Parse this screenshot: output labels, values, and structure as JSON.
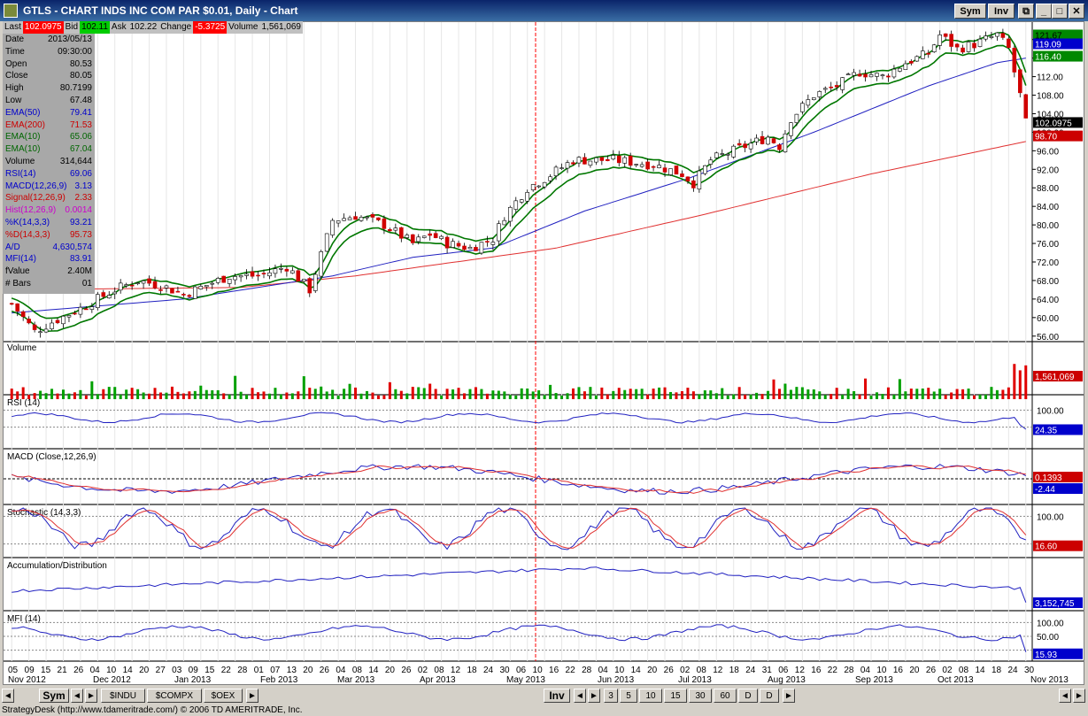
{
  "window": {
    "title": "GTLS - CHART INDS INC COM PAR $0.01, Daily - Chart",
    "sym_button": "Sym",
    "inv_button": "Inv"
  },
  "quote": {
    "last_label": "Last",
    "last_value": "102.0975",
    "bid_label": "Bid",
    "bid_value": "102.11",
    "ask_label": "Ask",
    "ask_value": "102.22",
    "change_label": "Change",
    "change_value": "-5.3725",
    "volume_label": "Volume",
    "volume_value": "1,561,069"
  },
  "data_panel": [
    {
      "k": "Date",
      "v": "2013/05/13",
      "color": "#000000"
    },
    {
      "k": "Time",
      "v": "09:30:00",
      "color": "#000000"
    },
    {
      "k": "Open",
      "v": "80.53",
      "color": "#000000"
    },
    {
      "k": "Close",
      "v": "80.05",
      "color": "#000000"
    },
    {
      "k": "High",
      "v": "80.7199",
      "color": "#000000"
    },
    {
      "k": "Low",
      "v": "67.48",
      "color": "#000000"
    },
    {
      "k": "EMA(50)",
      "v": "79.41",
      "color": "#0000cc"
    },
    {
      "k": "EMA(200)",
      "v": "71.53",
      "color": "#cc0000"
    },
    {
      "k": "EMA(10)",
      "v": "65.06",
      "color": "#006600"
    },
    {
      "k": "EMA(10)",
      "v": "67.04",
      "color": "#006600"
    },
    {
      "k": "Volume",
      "v": "314,644",
      "color": "#000000"
    },
    {
      "k": "RSI(14)",
      "v": "69.06",
      "color": "#0000cc"
    },
    {
      "k": "MACD(12,26,9)",
      "v": "3.13",
      "color": "#0000cc"
    },
    {
      "k": "Signal(12,26,9)",
      "v": "2.33",
      "color": "#cc0000"
    },
    {
      "k": "Hist(12,26,9)",
      "v": "0.0014",
      "color": "#cc00cc"
    },
    {
      "k": "%K(14,3,3)",
      "v": "93.21",
      "color": "#0000cc"
    },
    {
      "k": "%D(14,3,3)",
      "v": "95.73",
      "color": "#cc0000"
    },
    {
      "k": "A/D",
      "v": "4,630,574",
      "color": "#0000cc"
    },
    {
      "k": "MFI(14)",
      "v": "83.91",
      "color": "#0000cc"
    },
    {
      "k": "fValue",
      "v": "2.40M",
      "color": "#000000"
    },
    {
      "k": "# Bars",
      "v": "01",
      "color": "#000000"
    }
  ],
  "chart_data": {
    "type": "line",
    "price_axis": {
      "ylim": [
        55,
        123
      ],
      "ticks": [
        "120.00",
        "116.00",
        "112.00",
        "108.00",
        "104.00",
        "100.00",
        "96.00",
        "92.00",
        "88.00",
        "84.00",
        "80.00",
        "76.00",
        "72.00",
        "68.00",
        "64.00",
        "60.00",
        "56.00"
      ]
    },
    "price_keypoints": [
      [
        0,
        63
      ],
      [
        4,
        57
      ],
      [
        7,
        59
      ],
      [
        12,
        62
      ],
      [
        18,
        66
      ],
      [
        22,
        68
      ],
      [
        26,
        67
      ],
      [
        30,
        65
      ],
      [
        34,
        67
      ],
      [
        38,
        69
      ],
      [
        43,
        69
      ],
      [
        48,
        71
      ],
      [
        52,
        66
      ],
      [
        56,
        81
      ],
      [
        60,
        82
      ],
      [
        65,
        80
      ],
      [
        70,
        76
      ],
      [
        73,
        78
      ],
      [
        76,
        76
      ],
      [
        80,
        75
      ],
      [
        84,
        77
      ],
      [
        86,
        82
      ],
      [
        90,
        88
      ],
      [
        93,
        90
      ],
      [
        98,
        94
      ],
      [
        105,
        94
      ],
      [
        112,
        93
      ],
      [
        117,
        91
      ],
      [
        119,
        89
      ],
      [
        122,
        94
      ],
      [
        126,
        96
      ],
      [
        132,
        99
      ],
      [
        134,
        97
      ],
      [
        136,
        103
      ],
      [
        140,
        108
      ],
      [
        144,
        110
      ],
      [
        148,
        113
      ],
      [
        152,
        112
      ],
      [
        156,
        115
      ],
      [
        160,
        117
      ],
      [
        162,
        121
      ],
      [
        165,
        118
      ],
      [
        168,
        119
      ],
      [
        172,
        121
      ],
      [
        174,
        118
      ],
      [
        176,
        108
      ],
      [
        177,
        102
      ]
    ],
    "ema200_keypoints": [
      [
        0,
        66
      ],
      [
        40,
        66.5
      ],
      [
        60,
        69
      ],
      [
        95,
        75
      ],
      [
        120,
        82
      ],
      [
        150,
        91
      ],
      [
        177,
        98
      ]
    ],
    "ema50_keypoints": [
      [
        0,
        61
      ],
      [
        30,
        64
      ],
      [
        56,
        69
      ],
      [
        70,
        73
      ],
      [
        84,
        75
      ],
      [
        100,
        83
      ],
      [
        118,
        90
      ],
      [
        140,
        100
      ],
      [
        160,
        110
      ],
      [
        172,
        115
      ],
      [
        177,
        116
      ]
    ],
    "price_labels": [
      {
        "text": "121.67",
        "y": 121.0,
        "bg": "#008800",
        "fg": "#000000"
      },
      {
        "text": "119.09",
        "y": 119.09,
        "bg": "#0000cc",
        "fg": "#ffffff"
      },
      {
        "text": "116.40",
        "y": 116.4,
        "bg": "#008800",
        "fg": "#ffffff"
      },
      {
        "text": "102.0975",
        "y": 102.1,
        "bg": "#000000",
        "fg": "#ffffff"
      },
      {
        "text": "98.70",
        "y": 99.2,
        "bg": "#cc0000",
        "fg": "#ffffff"
      }
    ],
    "x_day_labels": [
      "05",
      "09",
      "15",
      "21",
      "26",
      "04",
      "10",
      "14",
      "20",
      "27",
      "03",
      "09",
      "15",
      "22",
      "28",
      "01",
      "07",
      "13",
      "20",
      "26",
      "04",
      "08",
      "14",
      "20",
      "26",
      "02",
      "08",
      "12",
      "18",
      "24",
      "30",
      "06",
      "10",
      "16",
      "22",
      "28",
      "04",
      "10",
      "14",
      "20",
      "26",
      "02",
      "08",
      "12",
      "18",
      "24",
      "31",
      "06",
      "12",
      "16",
      "22",
      "28",
      "04",
      "10",
      "16",
      "20",
      "26",
      "02",
      "08",
      "14",
      "18",
      "24",
      "30"
    ],
    "x_month_labels": [
      {
        "text": "Nov 2012",
        "x": 5
      },
      {
        "text": "Dec 2012",
        "x": 101
      },
      {
        "text": "Jan 2013",
        "x": 193
      },
      {
        "text": "Feb 2013",
        "x": 290
      },
      {
        "text": "Mar 2013",
        "x": 377
      },
      {
        "text": "Apr 2013",
        "x": 470
      },
      {
        "text": "May 2013",
        "x": 568
      },
      {
        "text": "Jun 2013",
        "x": 671
      },
      {
        "text": "Jul 2013",
        "x": 762
      },
      {
        "text": "Aug 2013",
        "x": 863
      },
      {
        "text": "Sep 2013",
        "x": 962
      },
      {
        "text": "Oct 2013",
        "x": 1055
      },
      {
        "text": "Nov 2013",
        "x": 1160
      }
    ],
    "panels": [
      {
        "name": "volume",
        "title": "Volume",
        "value_label": "1,561,069",
        "value_bg": "#cc0000"
      },
      {
        "name": "rsi",
        "title": "RSI (14)",
        "ticks": [
          "100.00"
        ],
        "value_label": "24.35",
        "value_bg": "#0000cc"
      },
      {
        "name": "macd",
        "title": "MACD (Close,12,26,9)",
        "value_label_1": "0.1393",
        "value_bg_1": "#cc0000",
        "value_label_2": "-2.44",
        "value_bg_2": "#0000cc"
      },
      {
        "name": "stochastic",
        "title": "Stochastic (14,3,3)",
        "ticks": [
          "100.00"
        ],
        "value_label": "16.60",
        "value_bg": "#cc0000"
      },
      {
        "name": "ad",
        "title": "Accumulation/Distribution",
        "value_label": "3,152,745",
        "value_bg": "#0000cc"
      },
      {
        "name": "mfi",
        "title": "MFI (14)",
        "ticks": [
          "100.00",
          "50.00"
        ],
        "value_label": "15.93",
        "value_bg": "#0000cc"
      }
    ]
  },
  "bottom_tabs": {
    "sym": "Sym",
    "symbols": [
      "$INDU",
      "$COMPX",
      "$OEX"
    ],
    "inv": "Inv",
    "intervals": [
      "3",
      "5",
      "10",
      "15",
      "30",
      "60",
      "D",
      "D"
    ]
  },
  "status": {
    "text": "StrategyDesk (http://www.tdameritrade.com/) © 2006 TD AMERITRADE, Inc."
  },
  "colors": {
    "up": "#008000",
    "down": "#d00000",
    "ema10": "#007700",
    "ema50": "#2020c0",
    "ema200": "#e03030",
    "cursor": "#ff0000"
  }
}
